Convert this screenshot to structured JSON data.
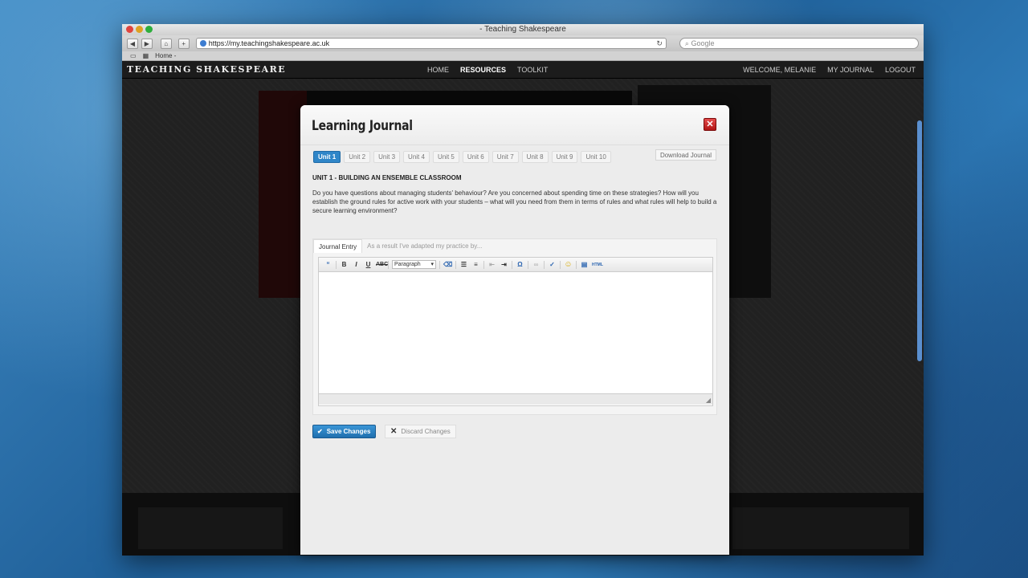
{
  "browser": {
    "window_title": "- Teaching Shakespeare",
    "url": "https://my.teachingshakespeare.ac.uk",
    "search_placeholder": "Google",
    "bookmark_home": "Home -"
  },
  "site": {
    "logo": "TEACHING SHAKESPEARE",
    "nav": [
      "HOME",
      "RESOURCES",
      "TOOLKIT"
    ],
    "user_nav": [
      "WELCOME, MELANIE",
      "MY JOURNAL",
      "LOGOUT"
    ]
  },
  "modal": {
    "title": "Learning Journal",
    "close_glyph": "✕",
    "units": [
      "Unit 1",
      "Unit 2",
      "Unit 3",
      "Unit 4",
      "Unit 5",
      "Unit 6",
      "Unit 7",
      "Unit 8",
      "Unit 9",
      "Unit 10"
    ],
    "active_unit": "Unit 1",
    "download_label": "Download Journal",
    "unit_heading": "UNIT 1 - BUILDING AN ENSEMBLE CLASSROOM",
    "unit_description": "Do you have questions about managing students' behaviour? Are you concerned about spending time on these strategies? How will you establish the ground rules for active work with your students – what will you need from them in terms of rules and what rules will help to build a secure learning environment?",
    "editor_tabs": [
      "Journal Entry",
      "As a result I've adapted my practice by..."
    ],
    "format_select": "Paragraph",
    "save_label": "Save Changes",
    "discard_label": "Discard Changes"
  }
}
